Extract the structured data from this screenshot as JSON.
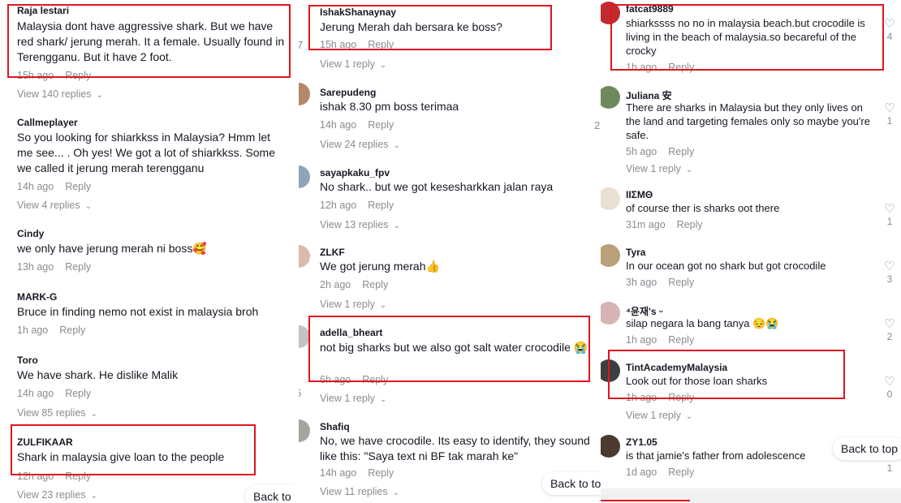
{
  "columns": [
    {
      "comments": [
        {
          "user": "Raja lestari",
          "text": "Malaysia dont have aggressive shark. But we have red shark/ jerung merah. It a female. Usually found in Terengganu. But it have 2 foot.",
          "time": "15h ago",
          "reply": "Reply",
          "replies": "View 140 replies"
        },
        {
          "user": "Callmeplayer",
          "text": "So you looking for shiarkkss in Malaysia? Hmm let me see... . Oh yes! We got a lot of shiarkkss. Some we called it jerung merah terengganu",
          "time": "14h ago",
          "reply": "Reply",
          "replies": "View 4 replies"
        },
        {
          "user": "Cindy",
          "text": "we only have jerung merah ni boss🥰",
          "time": "13h ago",
          "reply": "Reply",
          "replies": ""
        },
        {
          "user": "MARK-G",
          "text": "Bruce in finding nemo not exist in malaysia broh",
          "time": "1h ago",
          "reply": "Reply",
          "replies": ""
        },
        {
          "user": "Toro",
          "text": "We have shark. He dislike Malik",
          "time": "14h ago",
          "reply": "Reply",
          "replies": "View 85 replies"
        },
        {
          "user": "ZULFIKAAR",
          "text": "Shark in malaysia give loan to the people",
          "time": "12h ago",
          "reply": "Reply",
          "replies": "View 23 replies"
        }
      ],
      "back_to_top": "Back to t"
    },
    {
      "comments": [
        {
          "user": "IshakShanaynay",
          "text": "Jerung Merah dah bersara ke boss?",
          "time": "15h ago",
          "reply": "Reply",
          "replies": "View 1 reply"
        },
        {
          "user": "Sarepudeng",
          "text": "ishak 8.30 pm boss terimaa",
          "time": "14h ago",
          "reply": "Reply",
          "replies": "View 24 replies"
        },
        {
          "user": "sayapkaku_fpv",
          "text": "No shark.. but we got kesesharkkan jalan raya",
          "time": "12h ago",
          "reply": "Reply",
          "replies": "View 13 replies"
        },
        {
          "user": "ZLKF",
          "text": "We got jerung merah👍",
          "time": "2h ago",
          "reply": "Reply",
          "replies": "View 1 reply"
        },
        {
          "user": "adella_bheart",
          "text": "not big sharks but we also got salt water crocodile 😭",
          "time": "6h ago",
          "reply": "Reply",
          "replies": "View 1 reply"
        },
        {
          "user": "Shafiq",
          "text": "No, we have crocodile. Its easy to identify, they sound like this: \"Saya text ni BF tak marah ke\"",
          "time": "14h ago",
          "reply": "Reply",
          "replies": "View 11 replies"
        }
      ],
      "back_to_top": "Back to to",
      "stray": [
        "7",
        "2",
        "5"
      ]
    },
    {
      "comments": [
        {
          "user": "fatcat9889",
          "text": "shiarkssss no no in malaysia beach.but crocodile is living in the beach of malaysia.so becareful of the crocky",
          "time": "1h ago",
          "reply": "Reply",
          "replies": "",
          "likes": "4"
        },
        {
          "user": "Juliana 安",
          "text": "There are sharks in Malaysia but they only lives on the land and targeting females only so maybe you're safe.",
          "time": "5h ago",
          "reply": "Reply",
          "replies": "View 1 reply",
          "likes": "1"
        },
        {
          "user": "ΙΙΣΜΘ",
          "text": "of course ther is sharks oot there",
          "time": "31m ago",
          "reply": "Reply",
          "replies": "",
          "likes": "1"
        },
        {
          "user": "Tyra",
          "text": "In our ocean got no shark but got crocodile",
          "time": "3h ago",
          "reply": "Reply",
          "replies": "",
          "likes": "3"
        },
        {
          "user": "⁴윤재's ᵕ",
          "text": "silap negara la bang tanya 😔😭",
          "time": "1h ago",
          "reply": "Reply",
          "replies": "",
          "likes": "2"
        },
        {
          "user": "TintAcademyMalaysia",
          "text": "Look out for those loan sharks",
          "time": "1h ago",
          "reply": "Reply",
          "replies": "View 1 reply",
          "likes": "0"
        },
        {
          "user": "ZY1.05",
          "text": "is that jamie's father from adolescence",
          "time": "1d ago",
          "reply": "Reply",
          "replies": "",
          "likes": "1"
        }
      ],
      "back_to_top": "Back to top",
      "stray": [
        "2",
        "1",
        "1"
      ]
    }
  ],
  "colors": {
    "highlight": "#e0151f",
    "text": "#161823",
    "muted": "#8a8b91"
  }
}
